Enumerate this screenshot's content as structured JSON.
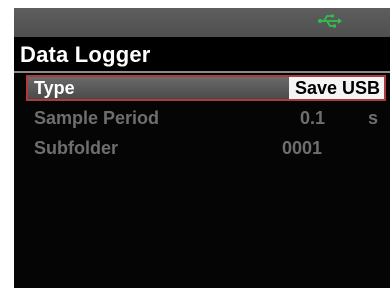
{
  "colors": {
    "usb_icon": "#2fbf4f",
    "selection_border": "#b03a3a",
    "inactive_text": "#6e6e6e"
  },
  "status_bar": {
    "icon": "usb-icon"
  },
  "title": "Data Logger",
  "menu": {
    "items": [
      {
        "label": "Type",
        "value": "Save USB",
        "unit": "",
        "selected": true
      },
      {
        "label": "Sample Period",
        "value": "0.1",
        "unit": "s",
        "selected": false
      },
      {
        "label": "Subfolder",
        "value": "0001",
        "unit": "",
        "selected": false
      }
    ]
  }
}
